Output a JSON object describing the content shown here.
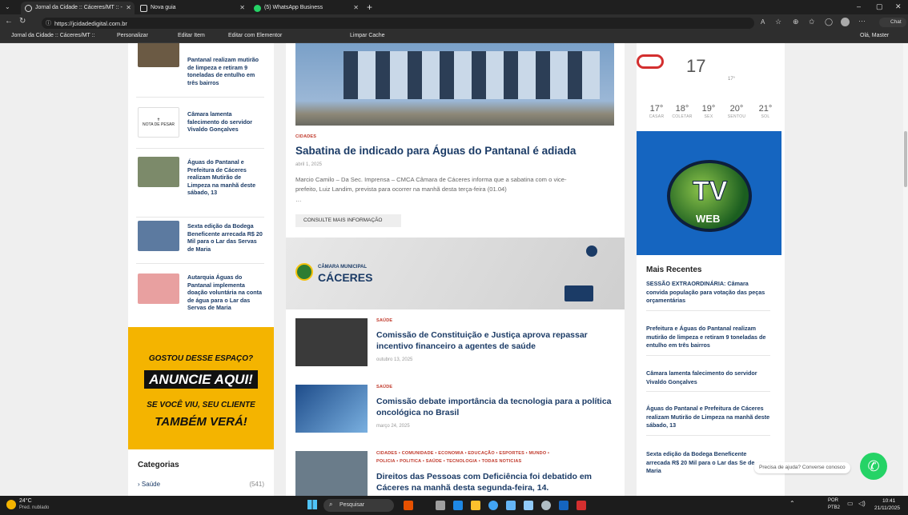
{
  "browser": {
    "tabs": [
      {
        "label": "Jornal da Cidade :: Cáceres/MT :: -",
        "active": true
      },
      {
        "label": "Nova guia",
        "active": false
      },
      {
        "label": "(5) WhatsApp Business",
        "active": false
      }
    ],
    "url": "https://jcidadedigital.com.br",
    "favorites": [
      "Jornal da Cidade :: Cáceres/MT ::",
      "Personalizar",
      "Editar Item",
      "Editar com Elementor",
      "Limpar Cache"
    ],
    "greeting": "Olá, Master"
  },
  "left_sidebar": {
    "posts": [
      {
        "title": "Pantanal realizam mutirão de limpeza e retiram 9 toneladas de entulho em três bairros"
      },
      {
        "title": "Câmara lamenta falecimento do servidor Vivaldo Gonçalves",
        "thumb_text": "NOTA DE PESAR"
      },
      {
        "title": "Águas do Pantanal e Prefeitura de Cáceres realizam Mutirão de Limpeza na manhã deste sábado, 13"
      },
      {
        "title": "Sexta edição da Bodega Beneficente arrecada R$ 20 Mil para o Lar das Servas de Maria"
      },
      {
        "title": "Autarquia Águas do Pantanal implementa doação voluntária na conta de água para o Lar das Servas de Maria"
      }
    ],
    "ad": {
      "line1": "GOSTOU DESSE ESPAÇO?",
      "line2": "ANUNCIE AQUI!",
      "line3": "SE VOCÊ VIU, SEU CLIENTE",
      "line4": "TAMBÉM VERÁ!"
    },
    "categories": {
      "heading": "Categorias",
      "items": [
        {
          "label": "Saúde",
          "count": "(541)"
        }
      ]
    }
  },
  "center": {
    "featured": {
      "category": "CIDADES",
      "title": "Sabatina de indicado para Águas do Pantanal é adiada",
      "date": "abril 1, 2025",
      "excerpt": "Marcio Camilo – Da Sec. Imprensa – CMCA  Câmara de Cáceres informa que a sabatina com o vice-prefeito, Luiz Landim, prevista para ocorrer na manhã desta terça-feira (01.04)",
      "ellipsis": "…",
      "button": "CONSULTE MAIS INFORMAÇÃO"
    },
    "banner": {
      "line1": "CÂMARA MUNICIPAL",
      "line2": "CÁCERES"
    },
    "articles": [
      {
        "category": "SAÚDE",
        "title": "Comissão de Constituição e Justiça aprova repassar incentivo financeiro a agentes de saúde",
        "date": "outubro 13, 2025"
      },
      {
        "category": "SAÚDE",
        "title": "Comissão debate importância da tecnologia para a política oncológica no Brasil",
        "date": "março 24, 2025"
      },
      {
        "category": "CIDADES  •  COMUNIDADE  •  ECONOMIA  •  EDUCAÇÃO  •  ESPORTES  •  MUNDO  •",
        "category2": "POLICIA  •  POLITICA  •  SAÚDE  •  TECNOLOGIA  •  TODAS NOTICIAS",
        "title": "Direitos das Pessoas com Deficiência foi debatido em Cáceres na manhã desta segunda-feira, 14."
      }
    ]
  },
  "right_sidebar": {
    "weather": {
      "temp": "17",
      "low": "17°",
      "days": [
        {
          "temp": "17°",
          "day": "CASAR"
        },
        {
          "temp": "18°",
          "day": "COLETAR"
        },
        {
          "temp": "19°",
          "day": "SEX"
        },
        {
          "temp": "20°",
          "day": "SENTOU"
        },
        {
          "temp": "21°",
          "day": "SOL"
        }
      ]
    },
    "tv_logo_text": "WEB",
    "recent_heading": "Mais Recentes",
    "recent": [
      "SESSÃO EXTRAORDINÁRIA: Câmara convida população para votação das peças orçamentárias",
      "Prefeitura e Águas do Pantanal realizam mutirão de limpeza e retiram 9 toneladas de entulho em três bairros",
      "Câmara lamenta falecimento do servidor Vivaldo Gonçalves",
      "Águas do Pantanal e Prefeitura de Cáceres realizam Mutirão de Limpeza na manhã deste sábado, 13",
      "Sexta edição da Bodega Beneficente arrecada R$ 20 Mil para o Lar das Se de Maria"
    ],
    "whatsapp_tip": "Precisa de ajuda? Converse conosco"
  },
  "taskbar": {
    "weather_temp": "24°C",
    "weather_desc": "Pred. nublado",
    "search": "Pesquisar",
    "lang1": "POR",
    "lang2": "PTB2",
    "time": "10:41",
    "date": "21/11/2025"
  },
  "colors": {
    "brand_blue": "#1b3b66",
    "accent_red": "#c0392b",
    "ad_yellow": "#f4b400",
    "whatsapp": "#25d366"
  }
}
